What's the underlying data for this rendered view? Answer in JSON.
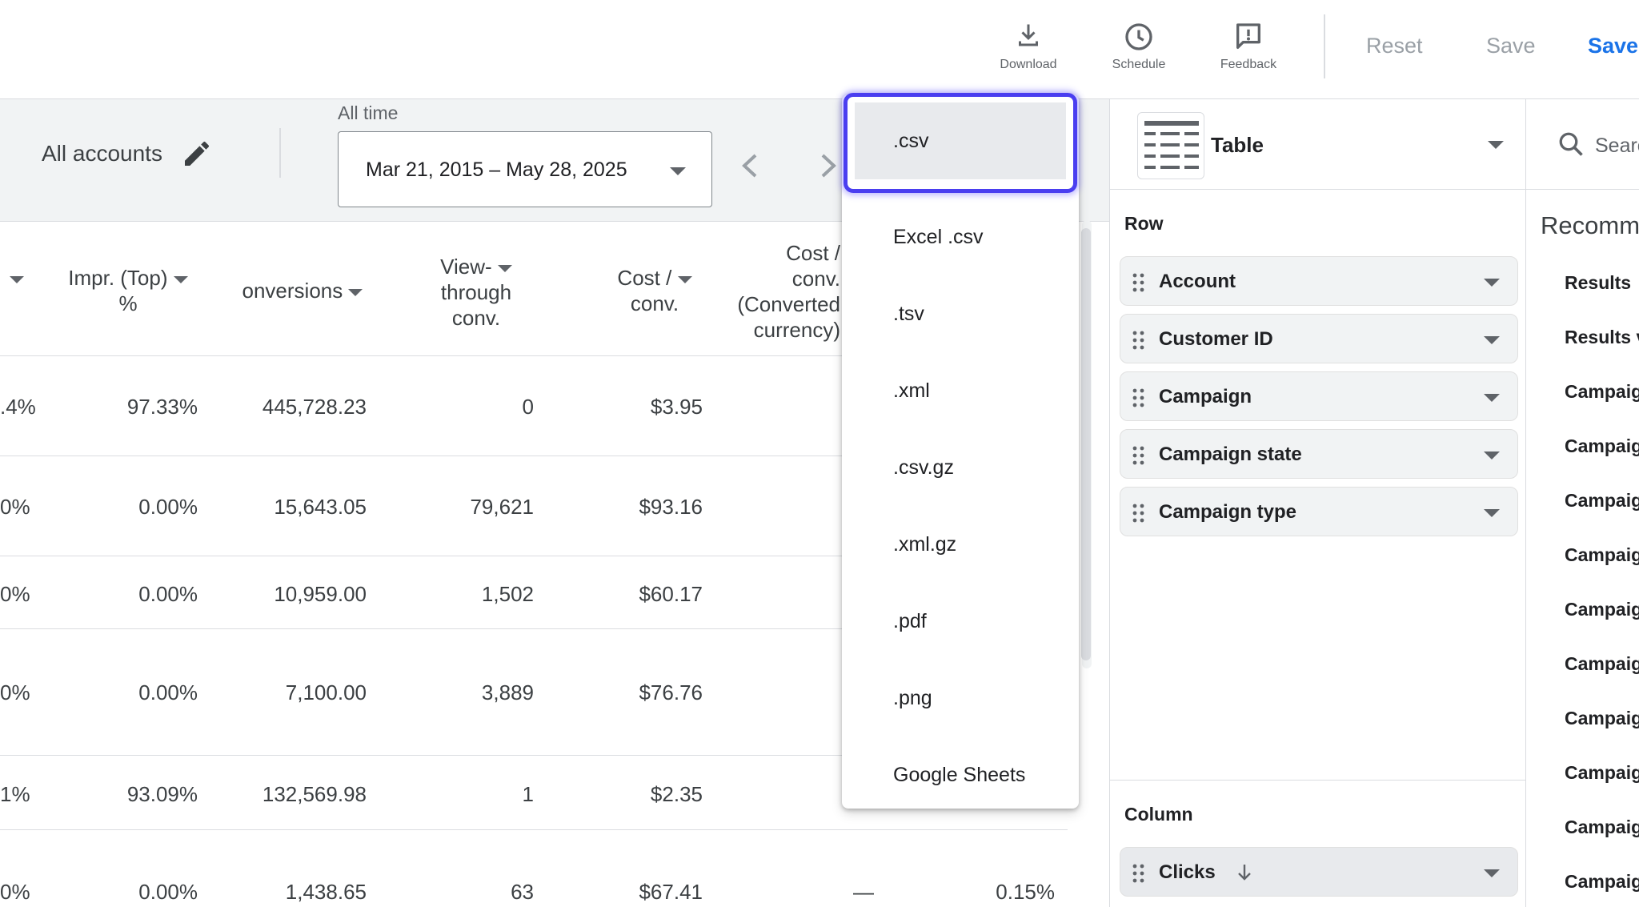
{
  "toolbar": {
    "download": "Download",
    "schedule": "Schedule",
    "feedback": "Feedback",
    "reset": "Reset",
    "save": "Save",
    "save_as": "Save"
  },
  "filters": {
    "accounts": "All accounts",
    "date_caption": "All time",
    "date_range": "Mar 21, 2015 – May 28, 2025"
  },
  "table": {
    "headers": {
      "impr_top": [
        "Impr. (Top)",
        "%"
      ],
      "conversions": "onversions",
      "view_through": [
        "View-",
        "through",
        "conv."
      ],
      "cost_conv": [
        "Cost /",
        "conv."
      ],
      "cost_conv_cc": [
        "Cost /",
        "conv.",
        "(Converted",
        "currency)"
      ]
    },
    "rows": [
      {
        "c0": ".4%",
        "impr_top": "97.33%",
        "conversions": "445,728.23",
        "view_through": "0",
        "cost_conv": "$3.95",
        "cc": "",
        "last": ""
      },
      {
        "c0": "0%",
        "impr_top": "0.00%",
        "conversions": "15,643.05",
        "view_through": "79,621",
        "cost_conv": "$93.16",
        "cc": "",
        "last": ""
      },
      {
        "c0": "0%",
        "impr_top": "0.00%",
        "conversions": "10,959.00",
        "view_through": "1,502",
        "cost_conv": "$60.17",
        "cc": "",
        "last": ""
      },
      {
        "c0": "0%",
        "impr_top": "0.00%",
        "conversions": "7,100.00",
        "view_through": "3,889",
        "cost_conv": "$76.76",
        "cc": "",
        "last": ""
      },
      {
        "c0": "1%",
        "impr_top": "93.09%",
        "conversions": "132,569.98",
        "view_through": "1",
        "cost_conv": "$2.35",
        "cc": "",
        "last": ""
      },
      {
        "c0": "0%",
        "impr_top": "0.00%",
        "conversions": "1,438.65",
        "view_through": "63",
        "cost_conv": "$67.41",
        "cc": "—",
        "last": "0.15%"
      }
    ]
  },
  "download_menu": {
    "items": [
      ".csv",
      "Excel .csv",
      ".tsv",
      ".xml",
      ".csv.gz",
      ".xml.gz",
      ".pdf",
      ".png",
      "Google Sheets"
    ],
    "selected": ".csv"
  },
  "panel": {
    "viz_type": "Table",
    "row_title": "Row",
    "row_items": [
      "Account",
      "Customer ID",
      "Campaign",
      "Campaign state",
      "Campaign type"
    ],
    "column_title": "Column",
    "column_items": [
      "Clicks"
    ]
  },
  "recommendations": {
    "search_placeholder": "Search",
    "title": "Recomm",
    "items": [
      "Results",
      "Results v",
      "Campaig",
      "Campaig",
      "Campaig",
      "Campaig",
      "Campaig",
      "Campaig",
      "Campaig",
      "Campaig",
      "Campaig",
      "Campaig"
    ]
  },
  "colors": {
    "accent": "#1a73e8",
    "focus_ring": "#4a3ef0",
    "muted": "#9aa0a6",
    "panel_bg": "#f1f3f4"
  },
  "icons": [
    "download-icon",
    "schedule-icon",
    "feedback-icon",
    "pencil-icon",
    "chevron-left-icon",
    "chevron-right-icon",
    "table-icon",
    "search-icon",
    "drag-handle-icon",
    "sort-arrow-icon"
  ]
}
